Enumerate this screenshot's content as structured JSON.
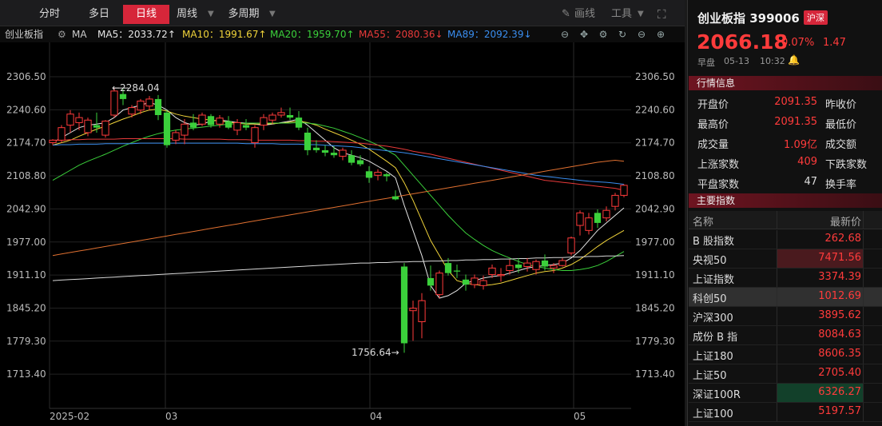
{
  "toolbar": {
    "tabs": [
      "分时",
      "多日",
      "日线",
      "周线",
      "多周期"
    ],
    "active_tab": "日线",
    "draw_label": "画线",
    "tools_label": "工具"
  },
  "ma_bar": {
    "index_name": "创业板指",
    "ma_label": "MA",
    "items": [
      {
        "label": "MA5：2033.72",
        "arrow": "↑",
        "color": "#e6e6e6"
      },
      {
        "label": "MA10：1991.67",
        "arrow": "↑",
        "color": "#f0d33a"
      },
      {
        "label": "MA20：1959.70",
        "arrow": "↑",
        "color": "#3bd03b"
      },
      {
        "label": "MA55：2080.36",
        "arrow": "↓",
        "color": "#e83a3a"
      },
      {
        "label": "MA89：2092.39",
        "arrow": "↓",
        "color": "#3a8ef0"
      }
    ]
  },
  "chart_data": {
    "type": "candlestick",
    "y_ticks": [
      "2306.50",
      "2240.60",
      "2174.70",
      "2108.80",
      "2042.90",
      "1977.00",
      "1911.10",
      "1845.20",
      "1779.30",
      "1713.40"
    ],
    "x_labels": [
      "2025-02",
      "03",
      "04",
      "05"
    ],
    "ylim": [
      1680,
      2330
    ],
    "annotations": {
      "high": "2284.04",
      "low": "1756.64"
    },
    "candles": [
      {
        "o": 2175,
        "h": 2182,
        "l": 2170,
        "c": 2180
      },
      {
        "o": 2180,
        "h": 2210,
        "l": 2175,
        "c": 2205
      },
      {
        "o": 2210,
        "h": 2240,
        "l": 2195,
        "c": 2232
      },
      {
        "o": 2215,
        "h": 2235,
        "l": 2200,
        "c": 2225
      },
      {
        "o": 2195,
        "h": 2225,
        "l": 2188,
        "c": 2220
      },
      {
        "o": 2210,
        "h": 2235,
        "l": 2195,
        "c": 2205
      },
      {
        "o": 2190,
        "h": 2220,
        "l": 2185,
        "c": 2218
      },
      {
        "o": 2230,
        "h": 2284,
        "l": 2225,
        "c": 2278
      },
      {
        "o": 2272,
        "h": 2282,
        "l": 2250,
        "c": 2262
      },
      {
        "o": 2232,
        "h": 2250,
        "l": 2225,
        "c": 2245
      },
      {
        "o": 2240,
        "h": 2262,
        "l": 2232,
        "c": 2258
      },
      {
        "o": 2248,
        "h": 2268,
        "l": 2240,
        "c": 2262
      },
      {
        "o": 2262,
        "h": 2270,
        "l": 2220,
        "c": 2230
      },
      {
        "o": 2235,
        "h": 2240,
        "l": 2165,
        "c": 2170
      },
      {
        "o": 2180,
        "h": 2200,
        "l": 2172,
        "c": 2195
      },
      {
        "o": 2190,
        "h": 2222,
        "l": 2172,
        "c": 2212
      },
      {
        "o": 2215,
        "h": 2232,
        "l": 2200,
        "c": 2205
      },
      {
        "o": 2212,
        "h": 2235,
        "l": 2208,
        "c": 2230
      },
      {
        "o": 2228,
        "h": 2232,
        "l": 2205,
        "c": 2210
      },
      {
        "o": 2212,
        "h": 2230,
        "l": 2205,
        "c": 2224
      },
      {
        "o": 2218,
        "h": 2228,
        "l": 2202,
        "c": 2205
      },
      {
        "o": 2200,
        "h": 2222,
        "l": 2190,
        "c": 2215
      },
      {
        "o": 2210,
        "h": 2222,
        "l": 2200,
        "c": 2205
      },
      {
        "o": 2175,
        "h": 2210,
        "l": 2165,
        "c": 2205
      },
      {
        "o": 2210,
        "h": 2232,
        "l": 2200,
        "c": 2225
      },
      {
        "o": 2220,
        "h": 2235,
        "l": 2212,
        "c": 2230
      },
      {
        "o": 2230,
        "h": 2245,
        "l": 2225,
        "c": 2235
      },
      {
        "o": 2230,
        "h": 2245,
        "l": 2220,
        "c": 2225
      },
      {
        "o": 2225,
        "h": 2238,
        "l": 2200,
        "c": 2205
      },
      {
        "o": 2195,
        "h": 2205,
        "l": 2150,
        "c": 2160
      },
      {
        "o": 2165,
        "h": 2180,
        "l": 2155,
        "c": 2160
      },
      {
        "o": 2160,
        "h": 2170,
        "l": 2148,
        "c": 2155
      },
      {
        "o": 2155,
        "h": 2168,
        "l": 2145,
        "c": 2150
      },
      {
        "o": 2148,
        "h": 2165,
        "l": 2140,
        "c": 2160
      },
      {
        "o": 2150,
        "h": 2160,
        "l": 2130,
        "c": 2135
      },
      {
        "o": 2140,
        "h": 2150,
        "l": 2128,
        "c": 2132
      },
      {
        "o": 2118,
        "h": 2128,
        "l": 2095,
        "c": 2105
      },
      {
        "o": 2110,
        "h": 2122,
        "l": 2100,
        "c": 2116
      },
      {
        "o": 2112,
        "h": 2115,
        "l": 2098,
        "c": 2108
      },
      {
        "o": 2068,
        "h": 2080,
        "l": 2060,
        "c": 2062
      },
      {
        "o": 1928,
        "h": 1935,
        "l": 1756,
        "c": 1775
      },
      {
        "o": 1840,
        "h": 1860,
        "l": 1780,
        "c": 1845
      },
      {
        "o": 1818,
        "h": 1875,
        "l": 1785,
        "c": 1860
      },
      {
        "o": 1905,
        "h": 1930,
        "l": 1880,
        "c": 1890
      },
      {
        "o": 1872,
        "h": 1920,
        "l": 1865,
        "c": 1915
      },
      {
        "o": 1935,
        "h": 1945,
        "l": 1910,
        "c": 1915
      },
      {
        "o": 1920,
        "h": 1932,
        "l": 1905,
        "c": 1918
      },
      {
        "o": 1902,
        "h": 1912,
        "l": 1880,
        "c": 1892
      },
      {
        "o": 1892,
        "h": 1912,
        "l": 1885,
        "c": 1905
      },
      {
        "o": 1890,
        "h": 1910,
        "l": 1882,
        "c": 1900
      },
      {
        "o": 1912,
        "h": 1932,
        "l": 1905,
        "c": 1925
      },
      {
        "o": 1910,
        "h": 1925,
        "l": 1898,
        "c": 1912
      },
      {
        "o": 1920,
        "h": 1942,
        "l": 1912,
        "c": 1930
      },
      {
        "o": 1932,
        "h": 1945,
        "l": 1915,
        "c": 1925
      },
      {
        "o": 1928,
        "h": 1945,
        "l": 1918,
        "c": 1935
      },
      {
        "o": 1922,
        "h": 1942,
        "l": 1912,
        "c": 1938
      },
      {
        "o": 1940,
        "h": 1952,
        "l": 1920,
        "c": 1928
      },
      {
        "o": 1925,
        "h": 1935,
        "l": 1915,
        "c": 1930
      },
      {
        "o": 1930,
        "h": 1945,
        "l": 1928,
        "c": 1940
      },
      {
        "o": 1955,
        "h": 1988,
        "l": 1950,
        "c": 1985
      },
      {
        "o": 2010,
        "h": 2040,
        "l": 1990,
        "c": 2035
      },
      {
        "o": 2000,
        "h": 2035,
        "l": 1992,
        "c": 2025
      },
      {
        "o": 2035,
        "h": 2042,
        "l": 2005,
        "c": 2015
      },
      {
        "o": 2025,
        "h": 2048,
        "l": 2018,
        "c": 2040
      },
      {
        "o": 2048,
        "h": 2075,
        "l": 2040,
        "c": 2070
      },
      {
        "o": 2070,
        "h": 2092,
        "l": 2066,
        "c": 2090
      }
    ],
    "ma_lines": [
      {
        "name": "MA5",
        "color": "#e6e6e6",
        "values": [
          2175,
          2185,
          2195,
          2205,
          2210,
          2212,
          2215,
          2225,
          2240,
          2245,
          2250,
          2255,
          2250,
          2240,
          2225,
          2215,
          2210,
          2212,
          2218,
          2220,
          2218,
          2215,
          2214,
          2212,
          2210,
          2212,
          2215,
          2218,
          2222,
          2210,
          2195,
          2180,
          2165,
          2155,
          2150,
          2145,
          2138,
          2128,
          2118,
          2105,
          2050,
          2000,
          1950,
          1890,
          1865,
          1870,
          1880,
          1895,
          1900,
          1905,
          1908,
          1910,
          1915,
          1920,
          1925,
          1928,
          1930,
          1932,
          1935,
          1945,
          1960,
          1980,
          2000,
          2015,
          2030,
          2045
        ]
      },
      {
        "name": "MA10",
        "color": "#f0d33a",
        "values": [
          2170,
          2175,
          2180,
          2188,
          2195,
          2202,
          2208,
          2215,
          2222,
          2228,
          2235,
          2240,
          2242,
          2238,
          2232,
          2228,
          2225,
          2222,
          2220,
          2218,
          2216,
          2214,
          2212,
          2212,
          2212,
          2213,
          2214,
          2216,
          2218,
          2215,
          2210,
          2202,
          2195,
          2188,
          2180,
          2172,
          2162,
          2150,
          2138,
          2125,
          2095,
          2060,
          2020,
          1980,
          1950,
          1920,
          1900,
          1895,
          1892,
          1890,
          1892,
          1895,
          1900,
          1905,
          1910,
          1915,
          1918,
          1920,
          1925,
          1932,
          1942,
          1955,
          1968,
          1980,
          1990,
          2000
        ]
      },
      {
        "name": "MA20",
        "color": "#3bd03b",
        "values": [
          2100,
          2110,
          2120,
          2130,
          2138,
          2145,
          2152,
          2160,
          2168,
          2175,
          2182,
          2188,
          2193,
          2197,
          2200,
          2202,
          2204,
          2206,
          2208,
          2210,
          2212,
          2213,
          2214,
          2214,
          2214,
          2214,
          2214,
          2214,
          2215,
          2214,
          2212,
          2208,
          2204,
          2198,
          2192,
          2185,
          2178,
          2170,
          2160,
          2150,
          2130,
          2110,
          2090,
          2070,
          2050,
          2030,
          2012,
          1995,
          1982,
          1970,
          1960,
          1952,
          1945,
          1938,
          1932,
          1928,
          1925,
          1922,
          1920,
          1920,
          1922,
          1925,
          1930,
          1938,
          1948,
          1958
        ]
      },
      {
        "name": "MA55",
        "color": "#e83a3a",
        "values": [
          2180,
          2180,
          2181,
          2181,
          2182,
          2182,
          2182,
          2182,
          2183,
          2183,
          2183,
          2183,
          2183,
          2183,
          2183,
          2182,
          2182,
          2182,
          2182,
          2182,
          2181,
          2181,
          2181,
          2180,
          2180,
          2180,
          2180,
          2180,
          2179,
          2179,
          2178,
          2178,
          2177,
          2176,
          2175,
          2174,
          2172,
          2170,
          2168,
          2165,
          2162,
          2158,
          2155,
          2152,
          2148,
          2144,
          2140,
          2136,
          2132,
          2128,
          2124,
          2120,
          2116,
          2112,
          2108,
          2104,
          2100,
          2098,
          2096,
          2094,
          2092,
          2090,
          2088,
          2086,
          2084,
          2080
        ]
      },
      {
        "name": "MA89",
        "color": "#3a8ef0",
        "values": [
          2170,
          2171,
          2171,
          2172,
          2172,
          2172,
          2173,
          2173,
          2173,
          2173,
          2174,
          2174,
          2174,
          2174,
          2174,
          2174,
          2174,
          2174,
          2174,
          2174,
          2174,
          2174,
          2173,
          2173,
          2173,
          2173,
          2172,
          2172,
          2172,
          2171,
          2171,
          2170,
          2169,
          2168,
          2167,
          2165,
          2163,
          2161,
          2159,
          2157,
          2155,
          2152,
          2149,
          2146,
          2143,
          2140,
          2137,
          2134,
          2131,
          2128,
          2125,
          2122,
          2119,
          2116,
          2113,
          2110,
          2108,
          2106,
          2104,
          2102,
          2100,
          2098,
          2097,
          2096,
          2094,
          2092
        ]
      },
      {
        "name": "MA250",
        "color": "#e07030",
        "values": [
          1950,
          1953,
          1956,
          1959,
          1962,
          1965,
          1968,
          1971,
          1974,
          1977,
          1980,
          1983,
          1986,
          1989,
          1992,
          1995,
          1998,
          2001,
          2004,
          2007,
          2010,
          2013,
          2016,
          2019,
          2022,
          2025,
          2028,
          2031,
          2034,
          2037,
          2040,
          2043,
          2046,
          2049,
          2052,
          2055,
          2058,
          2061,
          2064,
          2067,
          2070,
          2073,
          2076,
          2079,
          2082,
          2085,
          2088,
          2091,
          2094,
          2097,
          2100,
          2103,
          2106,
          2109,
          2112,
          2115,
          2118,
          2121,
          2124,
          2127,
          2130,
          2133,
          2136,
          2138,
          2140,
          2138
        ]
      },
      {
        "name": "MA500",
        "color": "#d8d8d8",
        "values": [
          1900,
          1901,
          1902,
          1903,
          1904,
          1905,
          1906,
          1907,
          1908,
          1909,
          1910,
          1911,
          1912,
          1913,
          1914,
          1915,
          1916,
          1917,
          1918,
          1919,
          1920,
          1921,
          1922,
          1923,
          1924,
          1925,
          1926,
          1927,
          1928,
          1929,
          1930,
          1931,
          1932,
          1933,
          1934,
          1935,
          1935,
          1936,
          1936,
          1937,
          1937,
          1938,
          1938,
          1939,
          1939,
          1940,
          1940,
          1941,
          1941,
          1942,
          1942,
          1943,
          1943,
          1944,
          1944,
          1945,
          1945,
          1946,
          1946,
          1947,
          1947,
          1948,
          1948,
          1949,
          1949,
          1950
        ]
      }
    ]
  },
  "quote": {
    "name": "创业板指 399006",
    "market_badge": "沪深",
    "price": "2066.18",
    "pct": "0.07%",
    "change": "1.47",
    "session": "早盘",
    "date": "05-13",
    "time": "10:32"
  },
  "market_section": {
    "title": "行情信息",
    "rows": [
      {
        "label": "开盘价",
        "value": "2091.35",
        "label2": "昨收价",
        "color": "#ff3b3b"
      },
      {
        "label": "最高价",
        "value": "2091.35",
        "label2": "最低价",
        "color": "#ff3b3b"
      },
      {
        "label": "成交量",
        "value": "1.09亿",
        "label2": "成交额",
        "color": "#ff3b3b"
      },
      {
        "label": "上涨家数",
        "value": "409",
        "label2": "下跌家数",
        "color": "#ff3b3b"
      },
      {
        "label": "平盘家数",
        "value": "47",
        "label2": "换手率",
        "color": "#dddddd"
      }
    ]
  },
  "index_section": {
    "title": "主要指数",
    "col_name": "名称",
    "col_price": "最新价",
    "rows": [
      {
        "name": "B 股指数",
        "value": "262.68",
        "bg": "",
        "hl": false
      },
      {
        "name": "央视50",
        "value": "7471.56",
        "bg": "#4a1a1e",
        "hl": false
      },
      {
        "name": "上证指数",
        "value": "3374.39",
        "bg": "",
        "hl": false
      },
      {
        "name": "科创50",
        "value": "1012.69",
        "bg": "",
        "hl": true
      },
      {
        "name": "沪深300",
        "value": "3895.62",
        "bg": "",
        "hl": false
      },
      {
        "name": "成份 B 指",
        "value": "8084.63",
        "bg": "",
        "hl": false
      },
      {
        "name": "上证180",
        "value": "8606.35",
        "bg": "",
        "hl": false
      },
      {
        "name": "上证50",
        "value": "2705.40",
        "bg": "",
        "hl": false
      },
      {
        "name": "深证100R",
        "value": "6326.27",
        "bg": "#12402a",
        "hl": false
      },
      {
        "name": "上证100",
        "value": "5197.57",
        "bg": "",
        "hl": false
      }
    ]
  }
}
